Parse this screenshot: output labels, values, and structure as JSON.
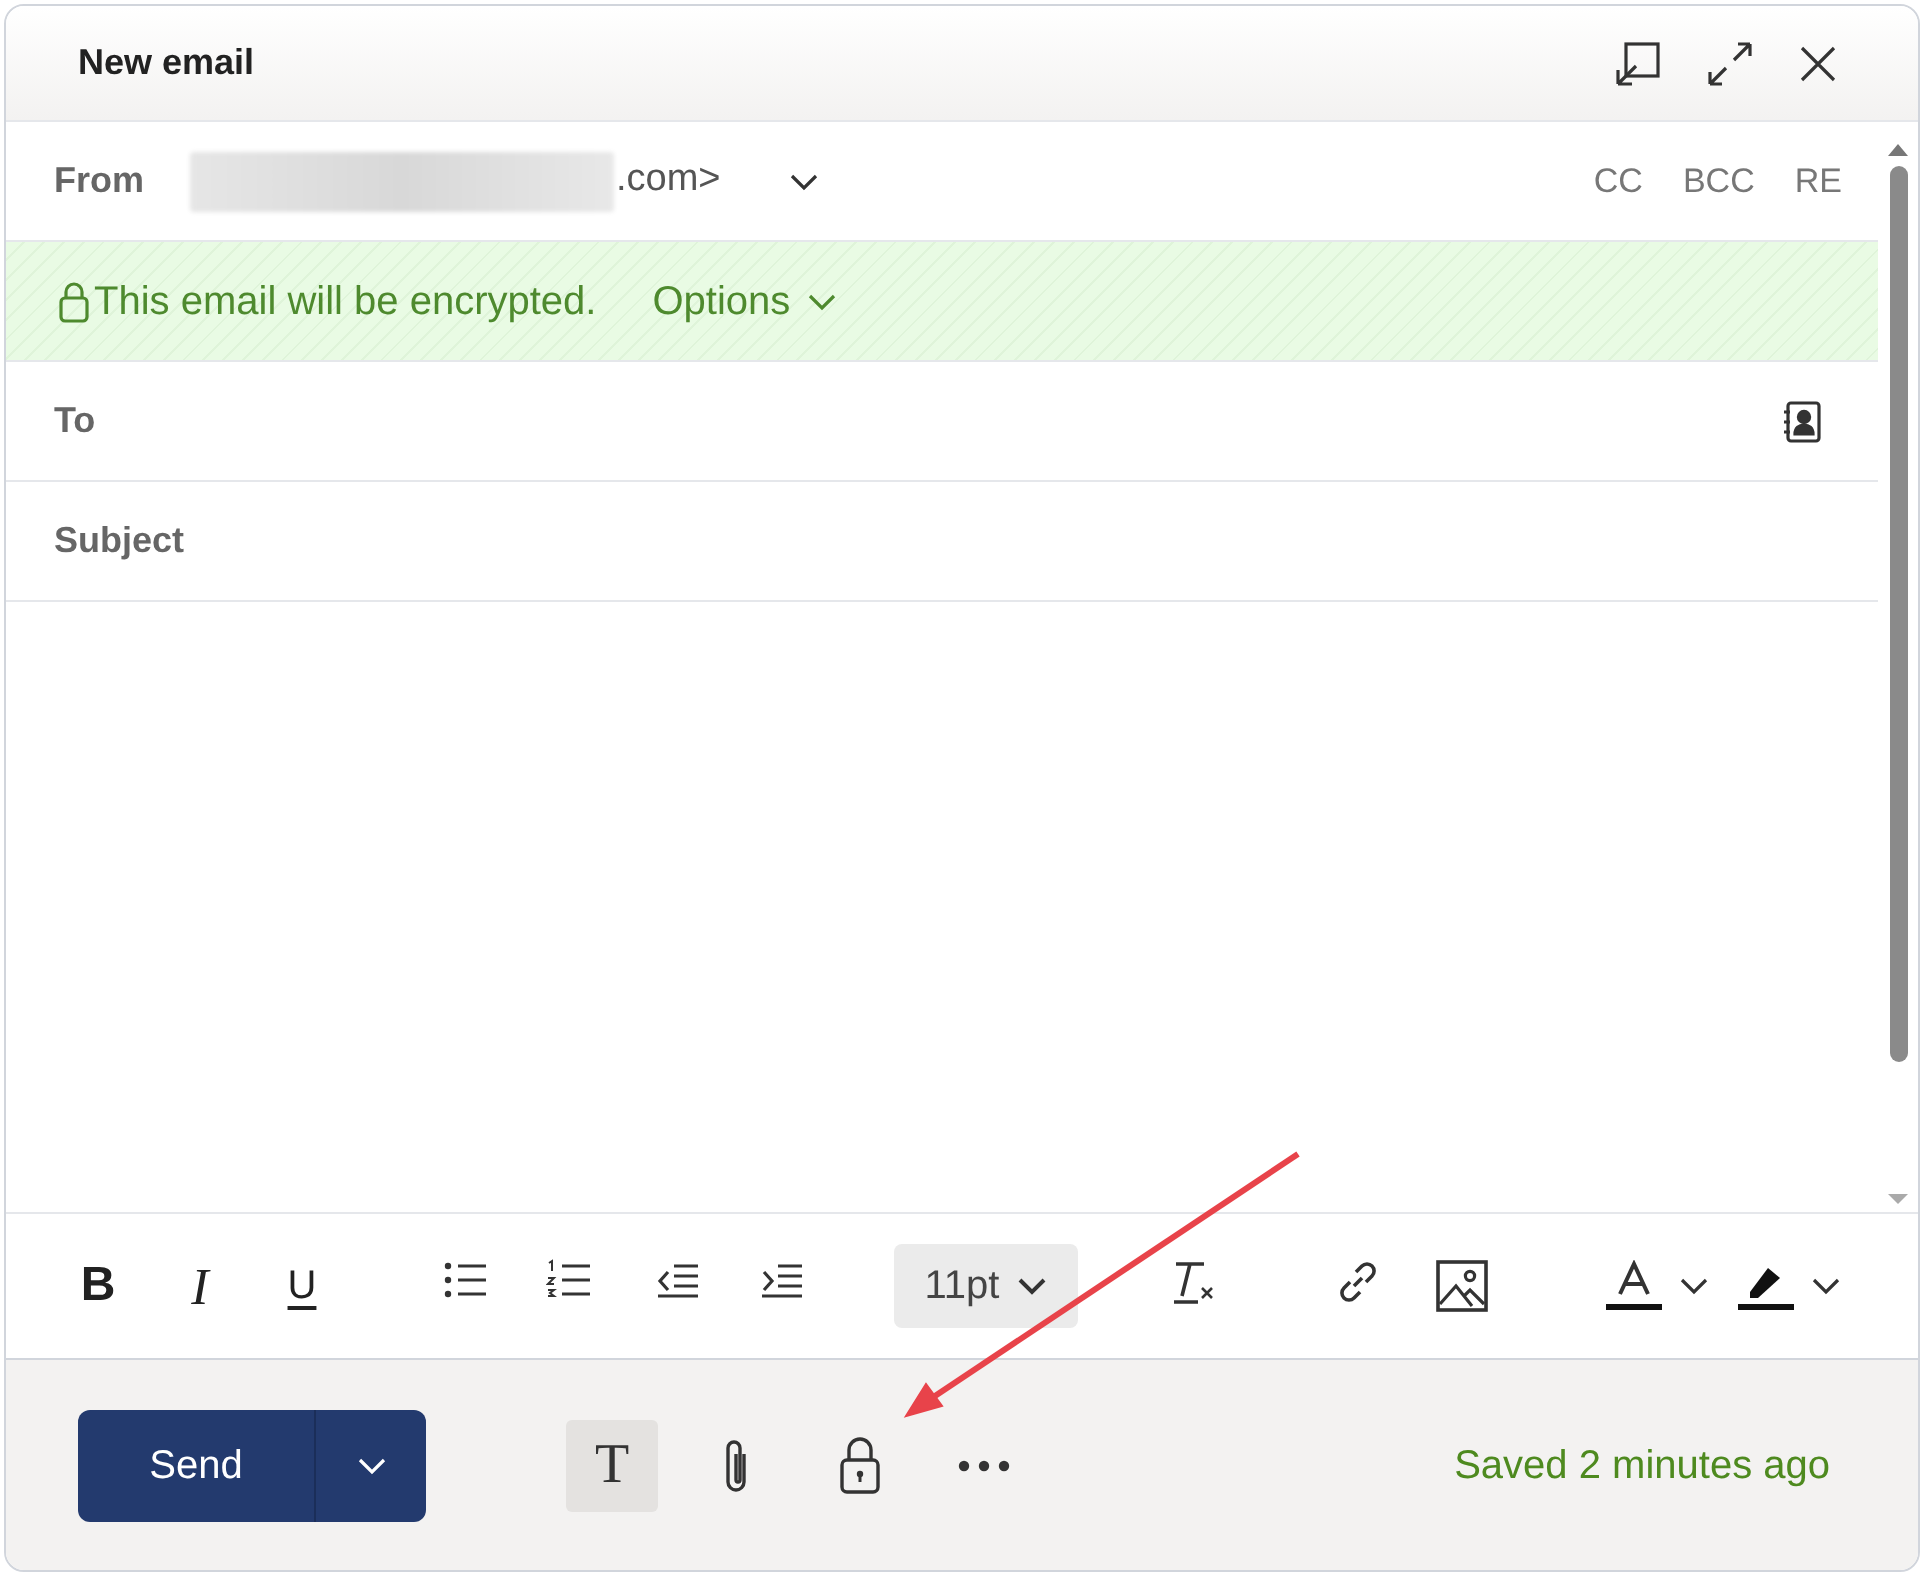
{
  "window": {
    "title": "New email"
  },
  "from": {
    "label": "From",
    "address": ".com>"
  },
  "recipient_links": [
    "CC",
    "BCC",
    "RE"
  ],
  "encryption": {
    "message": "This email will be encrypted.",
    "options": "Options"
  },
  "to": {
    "label": "To"
  },
  "subject": {
    "label": "Subject"
  },
  "format_toolbar": [
    {
      "kind": "bold",
      "text": "B"
    },
    {
      "kind": "italic",
      "text": "I"
    },
    {
      "kind": "underline",
      "text": "U"
    },
    {
      "kind": "bullets"
    },
    {
      "kind": "numbering"
    },
    {
      "kind": "outdent"
    },
    {
      "kind": "indent"
    },
    {
      "kind": "font-size",
      "text": "11pt"
    },
    {
      "kind": "clear-format"
    },
    {
      "kind": "link"
    },
    {
      "kind": "image"
    },
    {
      "kind": "font-color"
    },
    {
      "kind": "highlight"
    }
  ],
  "footer": {
    "send": "Send",
    "tools": [
      {
        "kind": "text",
        "text": "T",
        "selected": true
      },
      {
        "kind": "attach",
        "selected": false
      },
      {
        "kind": "encrypt",
        "selected": false
      },
      {
        "kind": "more",
        "selected": false
      }
    ],
    "status": "Saved 2 minutes ago"
  }
}
